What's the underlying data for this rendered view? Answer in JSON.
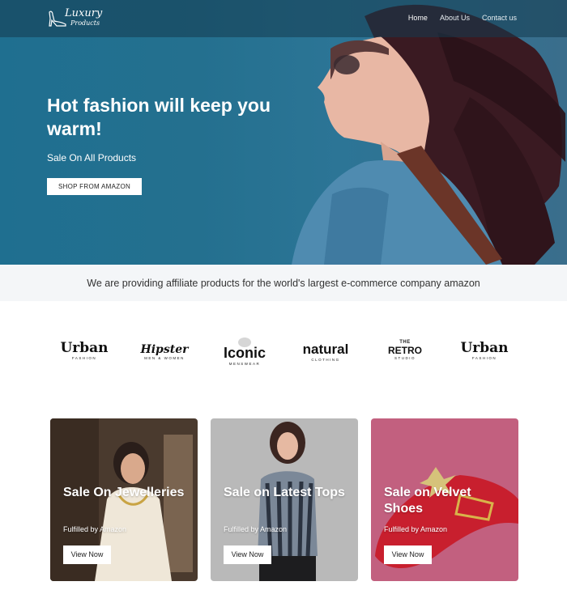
{
  "logo": {
    "line1": "Luxury",
    "line2": "Products"
  },
  "nav": {
    "items": [
      {
        "label": "Home"
      },
      {
        "label": "About Us"
      },
      {
        "label": "Contact us"
      }
    ]
  },
  "hero": {
    "title": "Hot fashion will keep you warm!",
    "subtitle": "Sale On All Products",
    "button": "SHOP FROM AMAZON"
  },
  "banner": {
    "text": "We are providing affiliate products for the world's largest e-commerce company amazon"
  },
  "brands": [
    {
      "main": "Urban",
      "sub": "FASHION"
    },
    {
      "main": "Hipster",
      "sub": "MEN & WOMEN"
    },
    {
      "main": "Iconic",
      "sub": "MENSWEAR"
    },
    {
      "main": "natural",
      "sub": "CLOTHING"
    },
    {
      "main": "RETRO",
      "pre": "THE",
      "sub": "STUDIO"
    },
    {
      "main": "Urban",
      "sub": "FASHION"
    }
  ],
  "cards": [
    {
      "title": "Sale On Jewelleries",
      "subtitle": "Fulfilled by Amazon",
      "button": "View Now"
    },
    {
      "title": "Sale on Latest Tops",
      "subtitle": "Fulfilled by Amazon",
      "button": "View Now"
    },
    {
      "title": "Sale on Velvet Shoes",
      "subtitle": "Fulfilled by Amazon",
      "button": "View Now"
    }
  ],
  "colors": {
    "hero_bg": "#24708f",
    "banner_bg": "#f4f6f8",
    "card1_bg": "#4a3a2e",
    "card2_bg": "#b9b9b9",
    "card3_bg": "#c2607f"
  }
}
